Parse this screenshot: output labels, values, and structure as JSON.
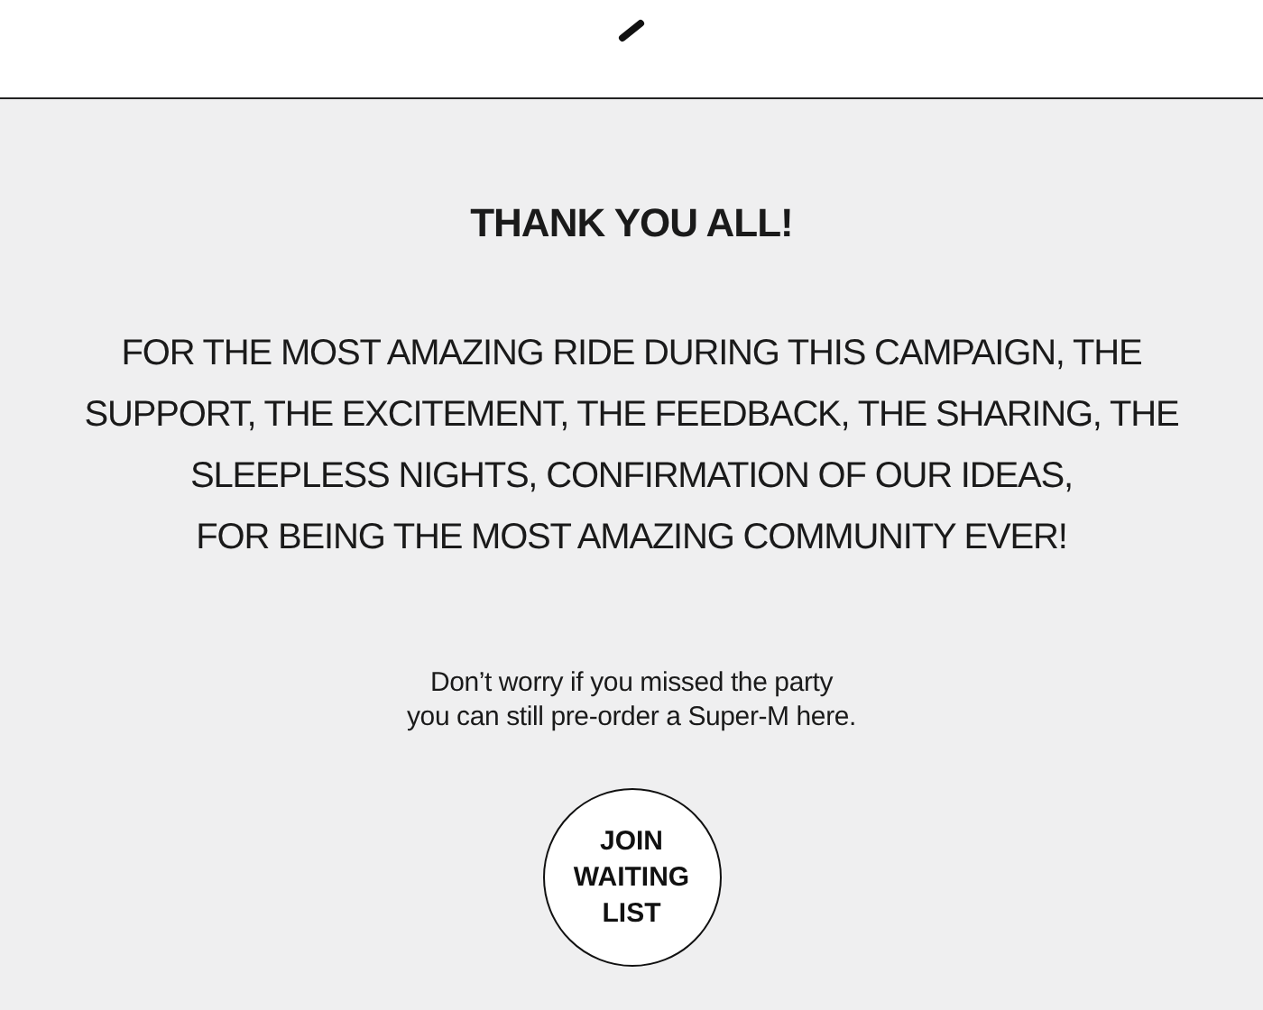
{
  "heading": "THANK YOU ALL!",
  "message_lines": [
    "FOR THE MOST AMAZING RIDE DURING THIS CAMPAIGN, THE",
    "SUPPORT, THE EXCITEMENT, THE FEEDBACK, THE SHARING, THE",
    "SLEEPLESS NIGHTS, CONFIRMATION OF OUR IDEAS,",
    "FOR BEING THE MOST AMAZING COMMUNITY EVER!"
  ],
  "note_lines": [
    "Don’t worry if you missed the party",
    "you can still pre-order a Super-M here."
  ],
  "button": {
    "lines": [
      "JOIN",
      "WAITING",
      "LIST"
    ]
  }
}
